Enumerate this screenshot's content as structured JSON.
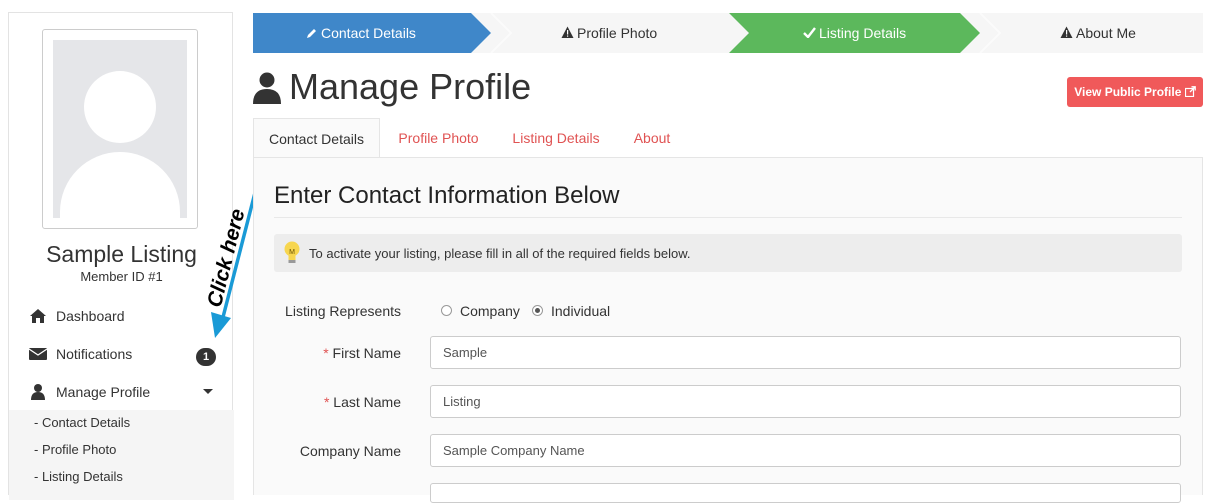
{
  "sidebar": {
    "name": "Sample Listing",
    "member_id": "Member ID #1",
    "nav": [
      {
        "label": "Dashboard",
        "icon": "home-icon"
      },
      {
        "label": "Notifications",
        "icon": "envelope-icon",
        "badge": "1"
      },
      {
        "label": "Manage Profile",
        "icon": "user-icon"
      }
    ],
    "subnav": [
      "- Contact Details",
      "- Profile Photo",
      "- Listing Details"
    ]
  },
  "annotation": {
    "text": "Click here",
    "color": "#1a9ad6"
  },
  "steps": [
    {
      "label": "Contact Details",
      "state": "active",
      "color": "#3f87c9",
      "icon": "pencil-icon"
    },
    {
      "label": "Profile Photo",
      "state": "warning",
      "icon": "warning-icon"
    },
    {
      "label": "Listing Details",
      "state": "complete",
      "color": "#5cb85c",
      "icon": "check-icon"
    },
    {
      "label": "About Me",
      "state": "warning",
      "icon": "warning-icon"
    }
  ],
  "header": {
    "title": "Manage Profile",
    "public_profile_button": "View Public Profile"
  },
  "tabs": [
    "Contact Details",
    "Profile Photo",
    "Listing Details",
    "About"
  ],
  "content": {
    "heading": "Enter Contact Information Below",
    "alert": "To activate your listing, please fill in all of the required fields below."
  },
  "form": {
    "listing_represents": {
      "label": "Listing Represents",
      "options": [
        "Company",
        "Individual"
      ],
      "selected": "Individual"
    },
    "first_name": {
      "label": "First Name",
      "value": "Sample",
      "required": true
    },
    "last_name": {
      "label": "Last Name",
      "value": "Listing",
      "required": true
    },
    "company_name": {
      "label": "Company Name",
      "value": "Sample Company Name"
    }
  }
}
